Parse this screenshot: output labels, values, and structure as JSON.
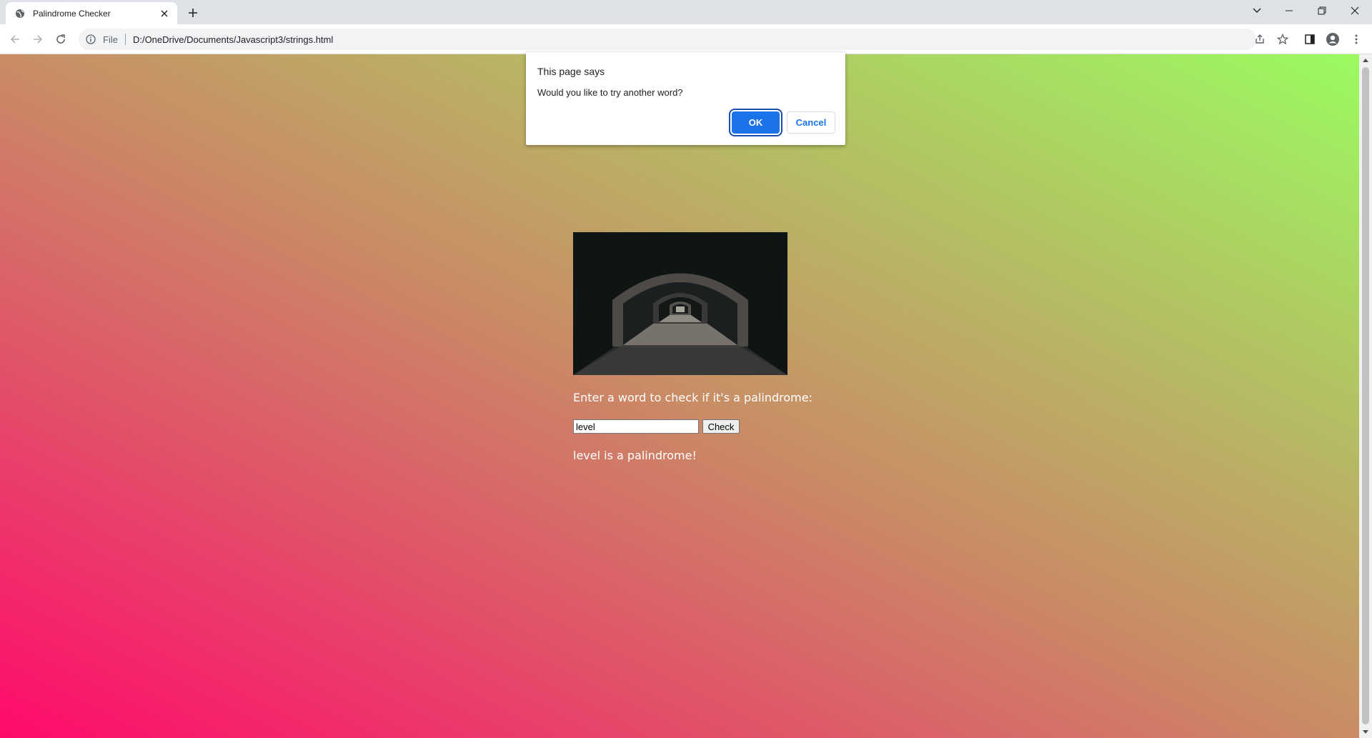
{
  "browser": {
    "tab_title": "Palindrome Checker",
    "omnibox_scheme": "File",
    "url": "D:/OneDrive/Documents/Javascript3/strings.html"
  },
  "dialog": {
    "title": "This page says",
    "message": "Would you like to try another word?",
    "ok_label": "OK",
    "cancel_label": "Cancel"
  },
  "page": {
    "prompt": "Enter a word to check if it's a palindrome:",
    "input_value": "level",
    "check_label": "Check",
    "result": "level is a palindrome!"
  },
  "colors": {
    "gradient_start": "#ff0a6c",
    "gradient_end": "#9bfb60",
    "accent": "#1a73e8"
  }
}
